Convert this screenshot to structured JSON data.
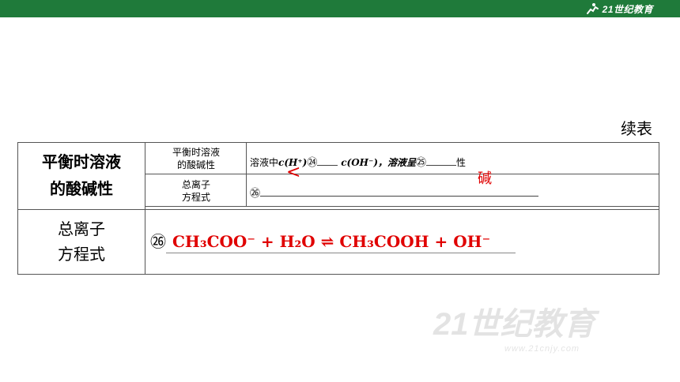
{
  "header": {
    "brand_text": "21世纪教育",
    "brand_color": "#1f7a3a"
  },
  "caption": "续表",
  "table": {
    "row1_label_line1": "平衡时溶液",
    "row1_label_line2": "的酸碱性",
    "inner_label_1_line1": "平衡时溶液",
    "inner_label_1_line2": "的酸碱性",
    "inner_text_1_part1": "溶液中",
    "inner_text_1_c_h": "c(H⁺)",
    "circ_24": "㉔",
    "inner_text_1_c_oh": "c(OH⁻)，溶液呈",
    "circ_25": "㉕",
    "inner_text_1_end": "性",
    "answer_24": "<",
    "answer_25": "碱",
    "inner_label_2_line1": "总离子",
    "inner_label_2_line2": "方程式",
    "circ_26_small": "㉖",
    "row2_label_line1": "总离子",
    "row2_label_line2": "方程式",
    "circ_26": "㉖",
    "equation": "CH₃COO⁻ + H₂O ⇌ CH₃COOH + OH⁻"
  },
  "watermark": {
    "text": "21世纪教育",
    "url_text": "www.21cnjy.com"
  },
  "colors": {
    "answer_red": "#e00000"
  }
}
